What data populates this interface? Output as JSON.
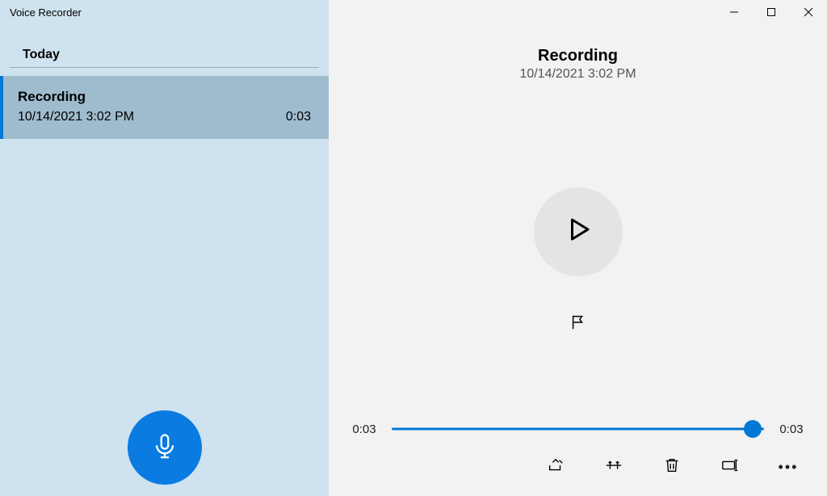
{
  "appTitle": "Voice Recorder",
  "sidebar": {
    "sectionHeader": "Today",
    "items": [
      {
        "title": "Recording",
        "date": "10/14/2021 3:02 PM",
        "duration": "0:03"
      }
    ]
  },
  "detail": {
    "title": "Recording",
    "date": "10/14/2021 3:02 PM",
    "timeline": {
      "current": "0:03",
      "total": "0:03",
      "positionPercent": 97
    }
  },
  "icons": {
    "minimize": "minimize-icon",
    "maximize": "maximize-icon",
    "close": "close-icon",
    "mic": "microphone-icon",
    "play": "play-icon",
    "flag": "flag-icon",
    "share": "share-icon",
    "trim": "trim-icon",
    "delete": "trash-icon",
    "rename": "rename-icon",
    "more": "more-icon"
  }
}
